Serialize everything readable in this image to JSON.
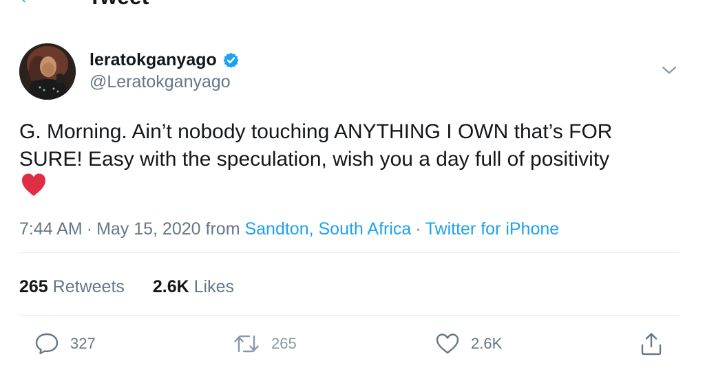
{
  "header": {
    "title": "Tweet"
  },
  "author": {
    "display_name": "leratokganyago",
    "handle": "@Leratokganyago",
    "verified": true
  },
  "tweet": {
    "text": "G. Morning. Ain’t nobody touching ANYTHING I OWN that’s FOR SURE! Easy with the speculation, wish you a day full of positivity",
    "emoji": "red-heart"
  },
  "meta": {
    "time": "7:44 AM",
    "date": "May 15, 2020",
    "from_label": "from",
    "location": "Sandton, South Africa",
    "client": "Twitter for iPhone"
  },
  "stats": {
    "retweets_count": "265",
    "retweets_label": "Retweets",
    "likes_count": "2.6K",
    "likes_label": "Likes"
  },
  "actions": {
    "reply_count": "327",
    "retweet_count": "265",
    "like_count": "2.6K"
  },
  "colors": {
    "accent": "#1da1f2",
    "secondary_text": "#657786",
    "primary_text": "#14171a",
    "divider": "#e1e8ed",
    "heart": "#dd2e44"
  }
}
